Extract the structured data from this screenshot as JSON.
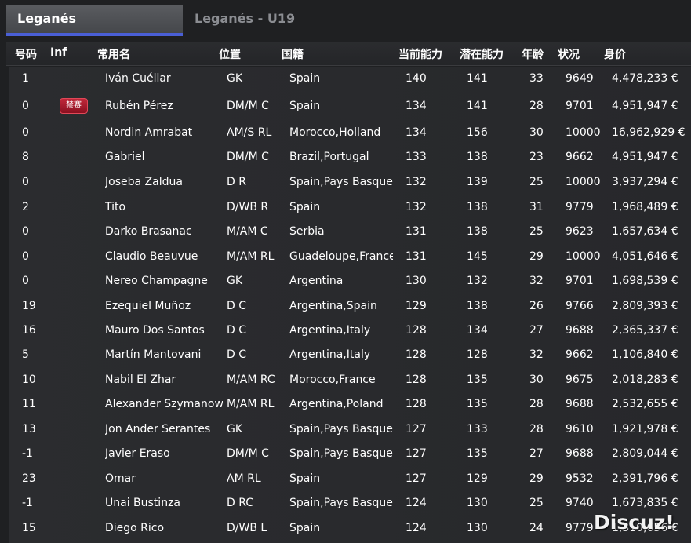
{
  "tabs": {
    "active_label": "Leganés",
    "inactive_label": "Leganés - U19"
  },
  "columns": [
    "号码",
    "Inf",
    "常用名",
    "位置",
    "国籍",
    "当前能力",
    "潜在能力",
    "年龄",
    "状况",
    "身价"
  ],
  "rows": [
    {
      "number": "1",
      "inf": "",
      "name": "Iván Cuéllar",
      "position": "GK",
      "nationality": "Spain",
      "ca": "140",
      "pa": "141",
      "age": "33",
      "condition": "9649",
      "value": "4,478,233 €"
    },
    {
      "number": "0",
      "inf": "禁赛",
      "name": "Rubén Pérez",
      "position": "DM/M C",
      "nationality": "Spain",
      "ca": "134",
      "pa": "141",
      "age": "28",
      "condition": "9701",
      "value": "4,951,947 €"
    },
    {
      "number": "0",
      "inf": "",
      "name": "Nordin Amrabat",
      "position": "AM/S RL",
      "nationality": "Morocco,Holland",
      "ca": "134",
      "pa": "156",
      "age": "30",
      "condition": "10000",
      "value": "16,962,929 €"
    },
    {
      "number": "8",
      "inf": "",
      "name": "Gabriel",
      "position": "DM/M C",
      "nationality": "Brazil,Portugal",
      "ca": "133",
      "pa": "138",
      "age": "23",
      "condition": "9662",
      "value": "4,951,947 €"
    },
    {
      "number": "0",
      "inf": "",
      "name": "Joseba Zaldua",
      "position": "D R",
      "nationality": "Spain,Pays Basque",
      "ca": "132",
      "pa": "139",
      "age": "25",
      "condition": "10000",
      "value": "3,937,294 €"
    },
    {
      "number": "2",
      "inf": "",
      "name": "Tito",
      "position": "D/WB R",
      "nationality": "Spain",
      "ca": "132",
      "pa": "138",
      "age": "31",
      "condition": "9779",
      "value": "1,968,489 €"
    },
    {
      "number": "0",
      "inf": "",
      "name": "Darko Brasanac",
      "position": "M/AM C",
      "nationality": "Serbia",
      "ca": "131",
      "pa": "138",
      "age": "25",
      "condition": "9623",
      "value": "1,657,634 €"
    },
    {
      "number": "0",
      "inf": "",
      "name": "Claudio Beauvue",
      "position": "M/AM RL",
      "nationality": "Guadeloupe,France",
      "ca": "131",
      "pa": "145",
      "age": "29",
      "condition": "10000",
      "value": "4,051,646 €"
    },
    {
      "number": "0",
      "inf": "",
      "name": "Nereo Champagne",
      "position": "GK",
      "nationality": "Argentina",
      "ca": "130",
      "pa": "132",
      "age": "32",
      "condition": "9701",
      "value": "1,698,539 €"
    },
    {
      "number": "19",
      "inf": "",
      "name": "Ezequiel Muñoz",
      "position": "D C",
      "nationality": "Argentina,Spain",
      "ca": "129",
      "pa": "138",
      "age": "26",
      "condition": "9766",
      "value": "2,809,393 €"
    },
    {
      "number": "16",
      "inf": "",
      "name": "Mauro Dos Santos",
      "position": "D C",
      "nationality": "Argentina,Italy",
      "ca": "128",
      "pa": "134",
      "age": "27",
      "condition": "9688",
      "value": "2,365,337 €"
    },
    {
      "number": "5",
      "inf": "",
      "name": "Martín Mantovani",
      "position": "D C",
      "nationality": "Argentina,Italy",
      "ca": "128",
      "pa": "128",
      "age": "32",
      "condition": "9662",
      "value": "1,106,840 €"
    },
    {
      "number": "10",
      "inf": "",
      "name": "Nabil El Zhar",
      "position": "M/AM RC",
      "nationality": "Morocco,France",
      "ca": "128",
      "pa": "135",
      "age": "30",
      "condition": "9675",
      "value": "2,018,283 €"
    },
    {
      "number": "11",
      "inf": "",
      "name": "Alexander Szymanowski",
      "position": "M/AM RL",
      "nationality": "Argentina,Poland",
      "ca": "128",
      "pa": "135",
      "age": "28",
      "condition": "9688",
      "value": "2,532,655 €"
    },
    {
      "number": "13",
      "inf": "",
      "name": "Jon Ander Serantes",
      "position": "GK",
      "nationality": "Spain,Pays Basque",
      "ca": "127",
      "pa": "133",
      "age": "28",
      "condition": "9610",
      "value": "1,921,978 €"
    },
    {
      "number": "-1",
      "inf": "",
      "name": "Javier Eraso",
      "position": "DM/M C",
      "nationality": "Spain,Pays Basque",
      "ca": "127",
      "pa": "135",
      "age": "27",
      "condition": "9688",
      "value": "2,809,044 €"
    },
    {
      "number": "23",
      "inf": "",
      "name": "Omar",
      "position": "AM RL",
      "nationality": "Spain",
      "ca": "127",
      "pa": "129",
      "age": "29",
      "condition": "9532",
      "value": "2,391,796 €"
    },
    {
      "number": "-1",
      "inf": "",
      "name": "Unai Bustinza",
      "position": "D RC",
      "nationality": "Spain,Pays Basque",
      "ca": "124",
      "pa": "130",
      "age": "25",
      "condition": "9740",
      "value": "1,673,835 €"
    },
    {
      "number": "15",
      "inf": "",
      "name": "Diego Rico",
      "position": "D/WB L",
      "nationality": "Spain",
      "ca": "124",
      "pa": "130",
      "age": "24",
      "condition": "9779",
      "value": "1,310,656 €"
    }
  ],
  "watermark": "Discuz!"
}
